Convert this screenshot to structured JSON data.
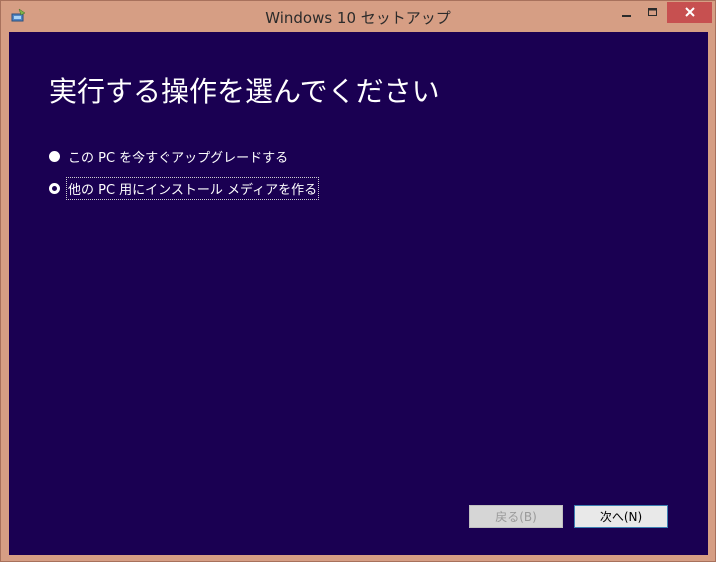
{
  "window": {
    "title": "Windows 10 セットアップ",
    "icon": "setup-app-icon",
    "controls": {
      "minimize": "▁",
      "maximize": "□",
      "close": "✕"
    }
  },
  "main": {
    "heading": "実行する操作を選んでください",
    "options": [
      {
        "label": "この PC を今すぐアップグレードする",
        "selected": false
      },
      {
        "label": "他の PC 用にインストール メディアを作る",
        "selected": true
      }
    ]
  },
  "footer": {
    "back_label": "戻る(B)",
    "next_label": "次へ(N)"
  },
  "colors": {
    "frame": "#d69e84",
    "background": "#1a0052",
    "close_button": "#c75050"
  }
}
